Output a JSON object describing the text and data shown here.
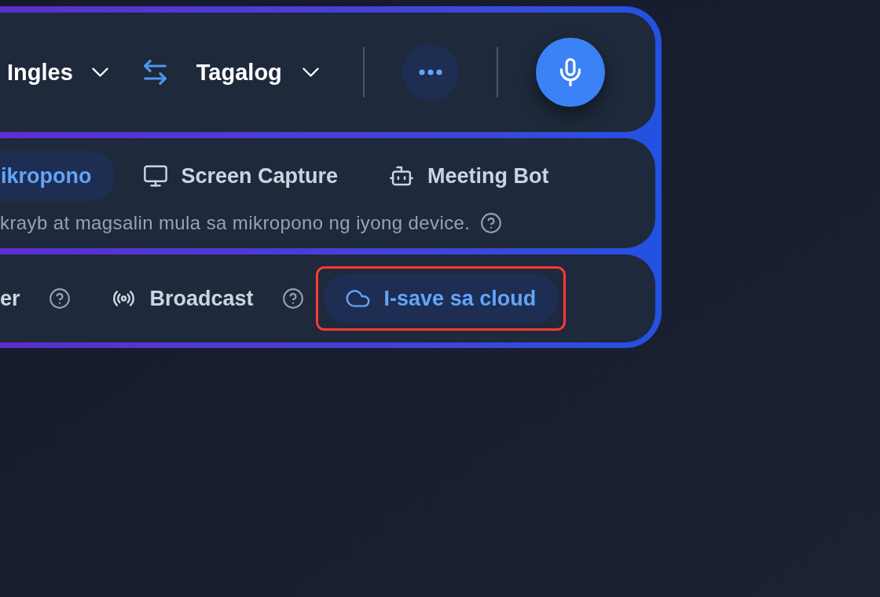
{
  "translator_bar": {
    "source_language": {
      "label": "Ingles"
    },
    "target_language": {
      "label": "Tagalog"
    }
  },
  "input_sources": {
    "tabs": [
      {
        "label": "ikropono",
        "selected": true
      },
      {
        "label": "Screen Capture",
        "selected": false
      },
      {
        "label": "Meeting Bot",
        "selected": false
      }
    ],
    "description": "krayb at magsalin mula sa mikropono ng iyong device."
  },
  "output_options": {
    "options": [
      {
        "label": "er"
      },
      {
        "label": "Broadcast"
      }
    ],
    "save_button": {
      "label": "I-save sa cloud",
      "highlighted": true
    }
  }
}
